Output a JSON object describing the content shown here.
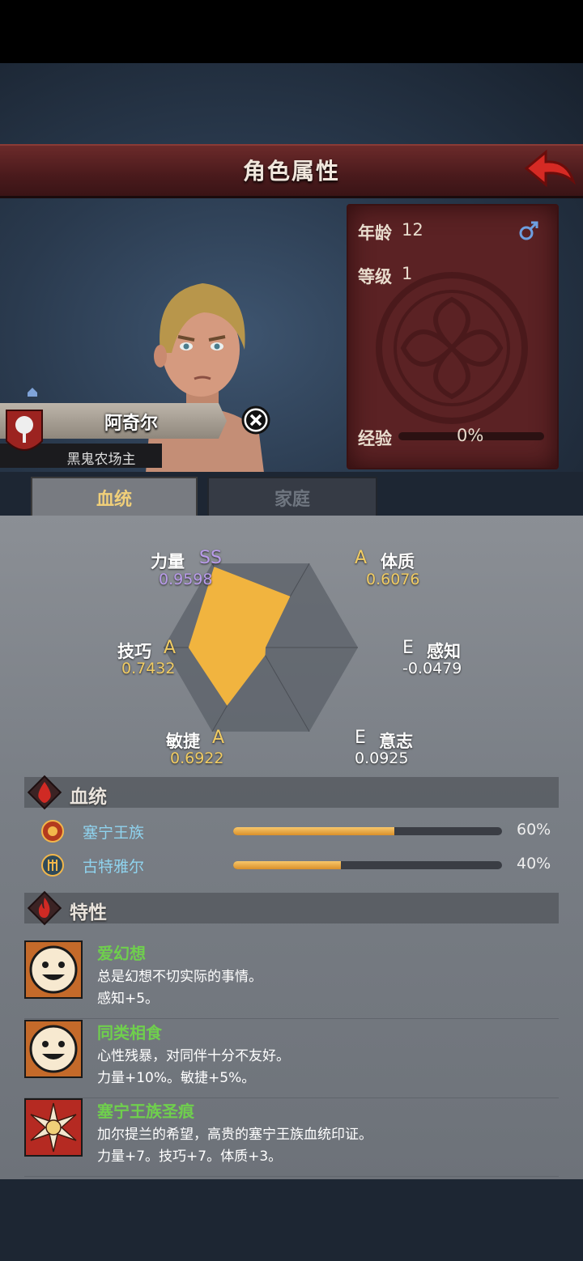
{
  "header": {
    "title": "角色属性",
    "back_icon": "back-arrow-icon"
  },
  "character": {
    "name": "阿奇尔",
    "title": "黑鬼农场主",
    "crest_icon": "tree-crest-icon",
    "age_label": "年龄",
    "age_value": "12",
    "gender_icon": "male-symbol-icon",
    "level_label": "等级",
    "level_value": "1",
    "exp_label": "经验",
    "exp_value": "0%",
    "exp_progress": 0
  },
  "tabs": [
    {
      "label": "血统",
      "active": true
    },
    {
      "label": "家庭",
      "active": false
    }
  ],
  "chart_data": {
    "type": "radar",
    "axes": [
      {
        "name": "力量",
        "grade": "SS",
        "value": 0.9598
      },
      {
        "name": "体质",
        "grade": "A",
        "value": 0.6076
      },
      {
        "name": "感知",
        "grade": "E",
        "value": -0.0479
      },
      {
        "name": "意志",
        "grade": "E",
        "value": 0.0925
      },
      {
        "name": "敏捷",
        "grade": "A",
        "value": 0.6922
      },
      {
        "name": "技巧",
        "grade": "A",
        "value": 0.7432
      }
    ],
    "value_labels": [
      "0.9598",
      "0.6076",
      "-0.0479",
      "0.0925",
      "0.6922",
      "0.7432"
    ],
    "fill_color": "#f1b43f"
  },
  "bloodline": {
    "title": "血统",
    "items": [
      {
        "name": "塞宁王族",
        "percent": "60%",
        "fraction": 0.6
      },
      {
        "name": "古特雅尔",
        "percent": "40%",
        "fraction": 0.4
      }
    ]
  },
  "traits": {
    "title": "特性",
    "items": [
      {
        "name": "爱幻想",
        "desc": "总是幻想不切实际的事情。",
        "effect": "感知+5。",
        "icon": "smiley-face-icon"
      },
      {
        "name": "同类相食",
        "desc": "心性残暴，对同伴十分不友好。",
        "effect": "力量+10%。敏捷+5%。",
        "icon": "smiley-face-icon"
      },
      {
        "name": "塞宁王族圣痕",
        "desc": "加尔提兰的希望，高贵的塞宁王族血统印证。",
        "effect": "力量+7。技巧+7。体质+3。",
        "icon": "holy-sun-icon"
      }
    ]
  }
}
